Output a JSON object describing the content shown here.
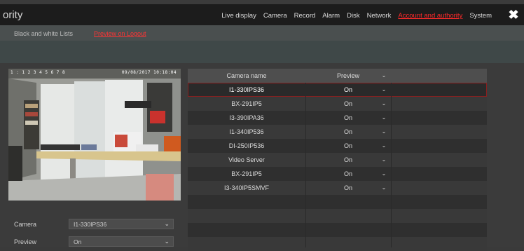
{
  "app": {
    "title": "ority",
    "close_glyph": "✖"
  },
  "nav": [
    "Live display",
    "Camera",
    "Record",
    "Alarm",
    "Disk",
    "Network",
    "Account and authority",
    "System"
  ],
  "nav_active_index": 6,
  "tabs": [
    "Black and white Lists",
    "Preview on Logout"
  ],
  "tabs_active_index": 1,
  "preview": {
    "osd_left": "1 : 1 2 3 4 5 6 7 8",
    "osd_right": "09/08/2017 10:18:04"
  },
  "form": {
    "camera_label": "Camera",
    "camera_value": "I1-330IPS36",
    "preview_label": "Preview",
    "preview_value": "On"
  },
  "table": {
    "headers": [
      "Camera name",
      "Preview"
    ],
    "rows": [
      {
        "name": "I1-330IPS36",
        "preview": "On",
        "selected": true
      },
      {
        "name": "BX-291IP5",
        "preview": "On",
        "selected": false
      },
      {
        "name": "I3-390IPA36",
        "preview": "On",
        "selected": false
      },
      {
        "name": "I1-340IP536",
        "preview": "On",
        "selected": false
      },
      {
        "name": "DI-250IP536",
        "preview": "On",
        "selected": false
      },
      {
        "name": "Video Server",
        "preview": "On",
        "selected": false
      },
      {
        "name": "BX-291IP5",
        "preview": "On",
        "selected": false
      },
      {
        "name": "I3-340IP5SMVF",
        "preview": "On",
        "selected": false
      }
    ]
  },
  "colors": {
    "accent": "#ff2a2a",
    "background": "#3b3b3b",
    "topbar": "#1c1c1c"
  },
  "icons": {
    "dropdown": "chevron-down-icon",
    "close": "close-icon"
  }
}
